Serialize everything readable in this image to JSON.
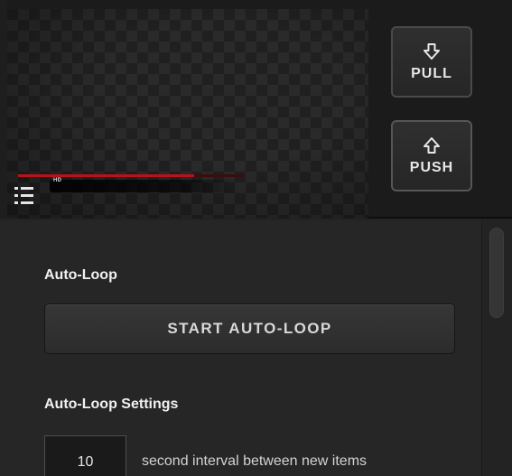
{
  "preview": {
    "hd_badge": "HD",
    "progress_fraction": 0.78,
    "list_icon": "list-icon"
  },
  "buttons": {
    "pull": {
      "label": "PULL",
      "icon": "arrow-down-outline-icon"
    },
    "push": {
      "label": "PUSH",
      "icon": "arrow-up-outline-icon"
    }
  },
  "auto_loop": {
    "heading": "Auto-Loop",
    "start_button_label": "START AUTO-LOOP"
  },
  "auto_loop_settings": {
    "heading": "Auto-Loop Settings",
    "interval_value": "10",
    "interval_label": "second interval between new items"
  },
  "colors": {
    "background": "#232323",
    "progress": "#b8121a",
    "text": "#f1f1f1"
  }
}
